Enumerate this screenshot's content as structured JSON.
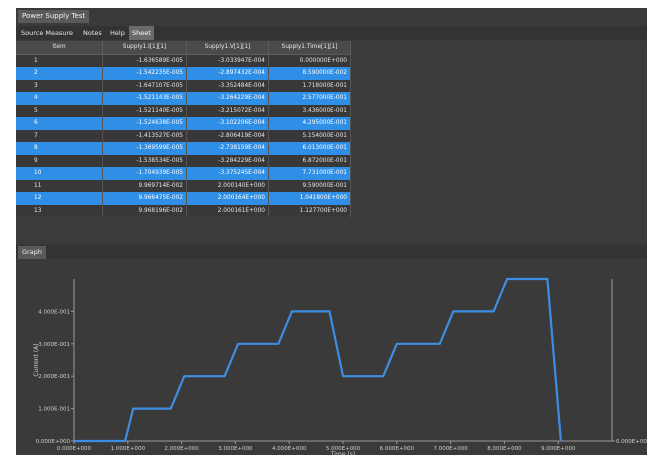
{
  "window": {
    "title": "Power Supply Test"
  },
  "menu": {
    "items": [
      "Source Measure",
      "Notes",
      "Help",
      "Sheet"
    ],
    "active": "Sheet"
  },
  "sheet": {
    "columns": [
      "Item",
      "Supply1.I[1][1]",
      "Supply1.V[1][1]",
      "Supply1.Time[1][1]"
    ],
    "rows": [
      [
        "1",
        "-1.636589E-005",
        "-3.033947E-004",
        "0.000000E+000"
      ],
      [
        "2",
        "-1.542235E-005",
        "-2.897432E-004",
        "8.590000E-002"
      ],
      [
        "3",
        "-1.647107E-005",
        "-3.352484E-004",
        "1.718000E-001"
      ],
      [
        "4",
        "-1.521143E-005",
        "-3.264229E-004",
        "2.577000E-001"
      ],
      [
        "5",
        "-1.521140E-005",
        "-3.215072E-004",
        "3.436000E-001"
      ],
      [
        "6",
        "-1.524638E-005",
        "-3.102206E-004",
        "4.295000E-001"
      ],
      [
        "7",
        "-1.413527E-005",
        "-2.806419E-004",
        "5.154000E-001"
      ],
      [
        "8",
        "-1.369599E-005",
        "-2.738159E-004",
        "6.013000E-001"
      ],
      [
        "9",
        "-1.538534E-005",
        "-3.284229E-004",
        "6.872000E-001"
      ],
      [
        "10",
        "-1.704939E-005",
        "-3.375245E-004",
        "7.731000E-001"
      ],
      [
        "11",
        "9.969714E-002",
        "2.000140E+000",
        "9.590000E-001"
      ],
      [
        "12",
        "9.966475E-002",
        "2.000164E+000",
        "1.041800E+000"
      ],
      [
        "13",
        "9.968196E-002",
        "2.000161E+000",
        "1.127700E+000"
      ]
    ],
    "selected_rows": [
      2,
      4,
      6,
      8,
      10,
      12
    ]
  },
  "graph": {
    "tab_label": "Graph",
    "y_ticks": [
      "0.000E+000",
      "1.000E-001",
      "2.000E-001",
      "3.000E-001",
      "4.000E-001"
    ],
    "x_ticks": [
      "0.000E+000",
      "1.000E+000",
      "2.000E+000",
      "3.000E+000",
      "4.000E+000",
      "5.000E+000",
      "6.000E+000",
      "7.000E+000",
      "8.000E+000",
      "9.000E+000"
    ],
    "right_tick": "0.000E+000",
    "xlabel": "Time (s)",
    "ylabel": "Current (A)",
    "line_color": "#3d8ee0"
  },
  "chart_data": {
    "type": "line",
    "x": [
      0.0,
      0.95,
      1.1,
      1.8,
      2.05,
      2.8,
      3.05,
      3.8,
      4.05,
      4.75,
      5.0,
      5.75,
      6.0,
      6.8,
      7.05,
      7.8,
      8.05,
      8.8,
      9.05
    ],
    "series": [
      {
        "values": [
          0.0,
          0.0,
          0.1,
          0.1,
          0.2,
          0.2,
          0.3,
          0.3,
          0.4,
          0.4,
          0.2,
          0.2,
          0.3,
          0.3,
          0.4,
          0.4,
          0.5,
          0.5,
          0.0
        ]
      }
    ],
    "xlim": [
      0,
      10
    ],
    "ylim": [
      0,
      0.5
    ]
  }
}
